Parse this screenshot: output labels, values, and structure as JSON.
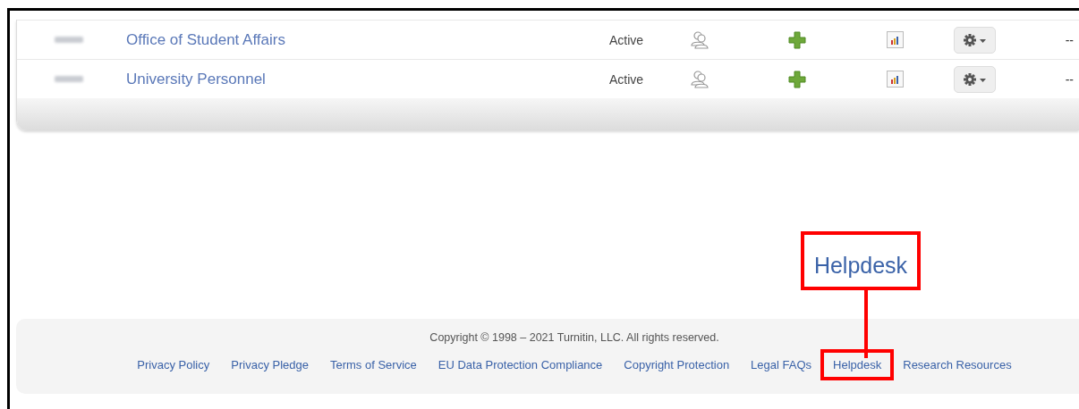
{
  "table": {
    "rows": [
      {
        "name": "Office of Student Affairs",
        "status": "Active",
        "column_8": "--"
      },
      {
        "name": "University Personnel",
        "status": "Active",
        "column_8": "--"
      }
    ]
  },
  "callout": {
    "label": "Helpdesk"
  },
  "footer": {
    "copyright": "Copyright © 1998 – 2021 Turnitin, LLC. All rights reserved.",
    "links": [
      {
        "label": "Privacy Policy",
        "highlighted": false
      },
      {
        "label": "Privacy Pledge",
        "highlighted": false
      },
      {
        "label": "Terms of Service",
        "highlighted": false
      },
      {
        "label": "EU Data Protection Compliance",
        "highlighted": false
      },
      {
        "label": "Copyright Protection",
        "highlighted": false
      },
      {
        "label": "Legal FAQs",
        "highlighted": false
      },
      {
        "label": "Helpdesk",
        "highlighted": true
      },
      {
        "label": "Research Resources",
        "highlighted": false
      }
    ]
  }
}
